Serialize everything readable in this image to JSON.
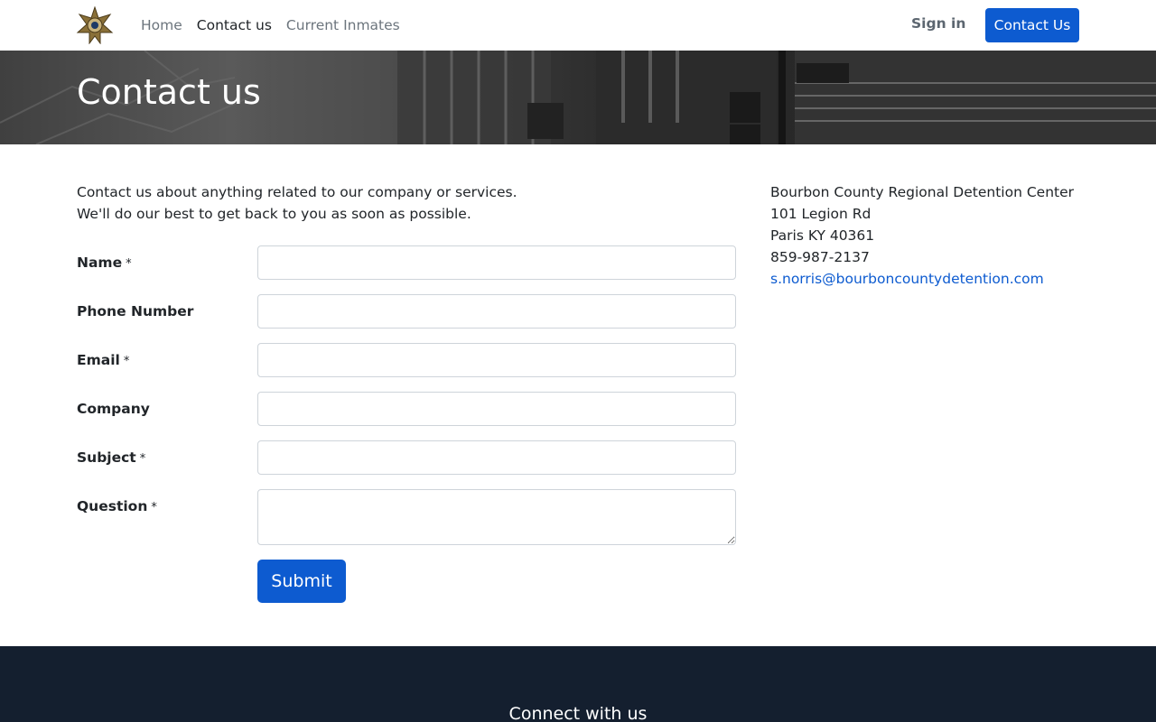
{
  "nav": {
    "logo_icon": "sheriff-star-badge-icon",
    "links": [
      "Home",
      "Contact us",
      "Current Inmates"
    ],
    "signin_label": "Sign in",
    "contact_button_label": "Contact Us"
  },
  "hero": {
    "title": "Contact us"
  },
  "intro": {
    "line1": "Contact us about anything related to our company or services.",
    "line2": "We'll do our best to get back to you as soon as possible."
  },
  "form": {
    "required_mark": "*",
    "fields": [
      {
        "label": "Name",
        "required": true,
        "value": ""
      },
      {
        "label": "Phone Number",
        "required": false,
        "value": ""
      },
      {
        "label": "Email",
        "required": true,
        "value": ""
      },
      {
        "label": "Company",
        "required": false,
        "value": ""
      },
      {
        "label": "Subject",
        "required": true,
        "value": ""
      },
      {
        "label": "Question",
        "required": true,
        "value": ""
      }
    ],
    "submit_label": "Submit"
  },
  "address": {
    "name": "Bourbon County Regional Detention Center",
    "street": "101 Legion Rd",
    "city": "Paris KY 40361",
    "phone": "859-987-2137",
    "email": "s.norris@bourboncountydetention.com"
  },
  "footer": {
    "title": "Connect with us"
  },
  "colors": {
    "primary": "#0d5bd0",
    "footer_bg": "#141f2f"
  }
}
